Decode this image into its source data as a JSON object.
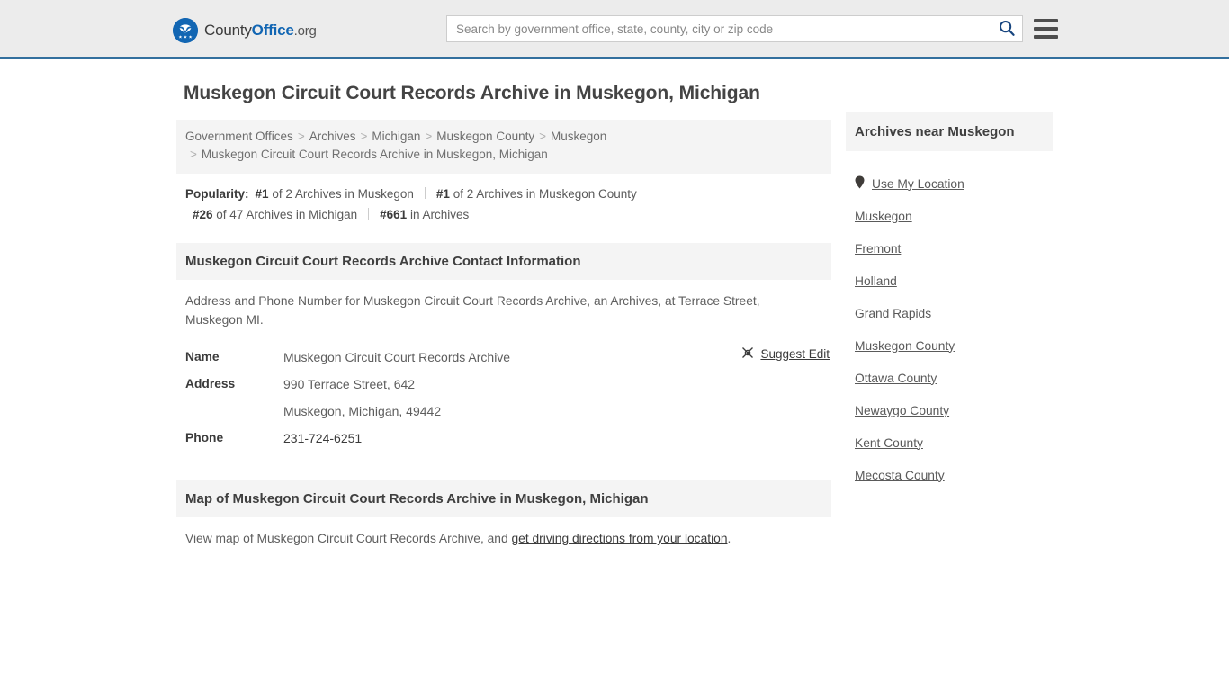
{
  "header": {
    "logo": {
      "icon": "eagle-seal-logo",
      "text_county": "County",
      "text_office": "Office",
      "text_org": ".org"
    },
    "search": {
      "placeholder": "Search by government office, state, county, city or zip code",
      "value": "",
      "search_icon": "search-icon"
    },
    "menu_icon": "hamburger-menu-icon"
  },
  "main": {
    "page_title": "Muskegon Circuit Court Records Archive in Muskegon, Michigan",
    "breadcrumb": {
      "separator": ">",
      "items": [
        "Government Offices",
        "Archives",
        "Michigan",
        "Muskegon County",
        "Muskegon"
      ],
      "current": "Muskegon Circuit Court Records Archive in Muskegon, Michigan"
    },
    "popularity": {
      "label": "Popularity:",
      "rank1_num": "#1",
      "rank1_text": "of 2 Archives in Muskegon",
      "rank2_num": "#1",
      "rank2_text": "of 2 Archives in Muskegon County",
      "rank3_num": "#26",
      "rank3_text": "of 47 Archives in Michigan",
      "rank4_num": "#661",
      "rank4_text": "in Archives"
    },
    "contact_section": {
      "heading": "Muskegon Circuit Court Records Archive Contact Information",
      "description": "Address and Phone Number for Muskegon Circuit Court Records Archive, an Archives, at Terrace Street, Muskegon MI.",
      "rows": [
        {
          "key": "Name",
          "value": "Muskegon Circuit Court Records Archive"
        },
        {
          "key": "Address",
          "value": "990 Terrace Street, 642"
        },
        {
          "key": "",
          "value": "Muskegon, Michigan, 49442"
        },
        {
          "key": "Phone",
          "value": "231-724-6251"
        }
      ],
      "suggest_edit": {
        "icon": "edit-pencil-icon",
        "label": "Suggest Edit"
      }
    },
    "map_section": {
      "heading": "Map of Muskegon Circuit Court Records Archive in Muskegon, Michigan",
      "text_before": "View map of Muskegon Circuit Court Records Archive, and ",
      "link": "get driving directions from your location",
      "text_after": "."
    }
  },
  "sidebar": {
    "heading": "Archives near Muskegon",
    "use_my_location": {
      "icon": "map-pin-icon",
      "label": "Use My Location"
    },
    "links": [
      "Muskegon",
      "Fremont",
      "Holland",
      "Grand Rapids",
      "Muskegon County",
      "Ottawa County",
      "Newaygo County",
      "Kent County",
      "Mecosta County"
    ]
  },
  "colors": {
    "header_bg": "#ececec",
    "header_border": "#33709e",
    "brand_blue": "#1266b3",
    "section_bg": "#f4f4f4",
    "text": "#4a4a4a"
  }
}
